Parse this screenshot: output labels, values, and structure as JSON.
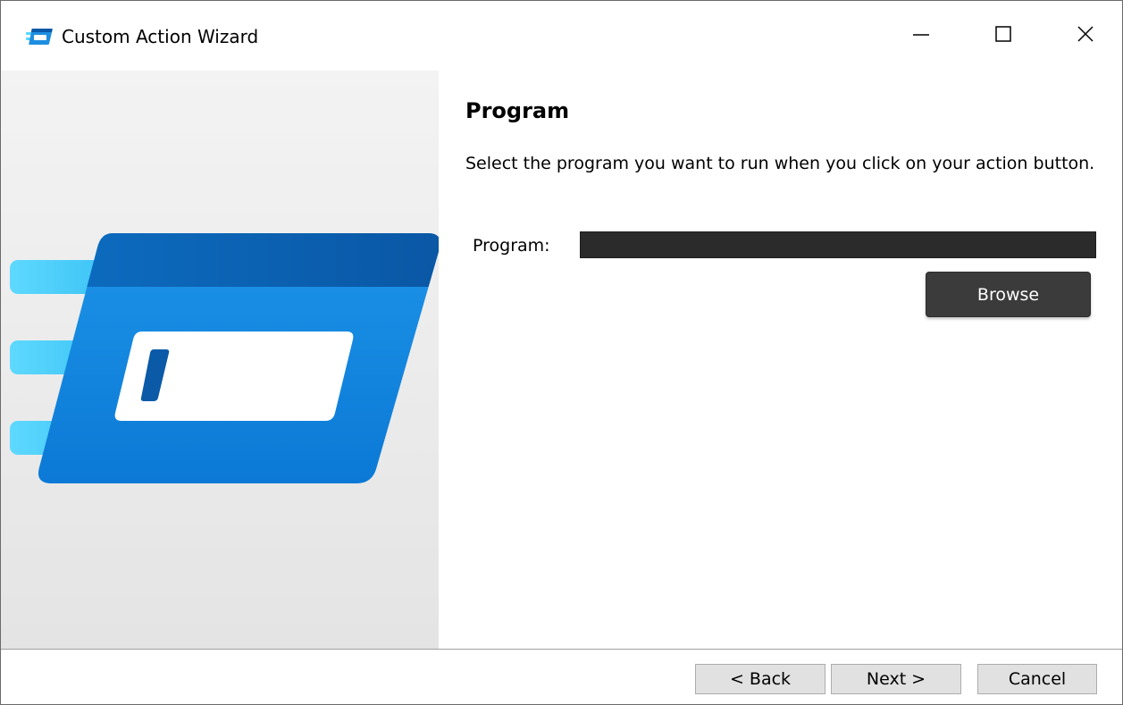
{
  "window": {
    "title": "Custom Action Wizard",
    "icons": {
      "app": "custom-action-app-icon",
      "minimize": "minimize-icon",
      "maximize": "maximize-icon",
      "close": "close-icon"
    }
  },
  "page": {
    "heading": "Program",
    "description": "Select the program you want to run when you click on your action button."
  },
  "program_field": {
    "label": "Program:",
    "value": ""
  },
  "buttons": {
    "browse": "Browse",
    "back": "< Back",
    "next": "Next >",
    "cancel": "Cancel"
  },
  "illustration": {
    "icon": "action-button-illustration"
  },
  "colors": {
    "accent_dark": "#0a5aa8",
    "accent": "#0f7fd8",
    "accent_light": "#58d6ff",
    "dark_field": "#2b2b2b",
    "browse_button": "#3b3b3b"
  }
}
